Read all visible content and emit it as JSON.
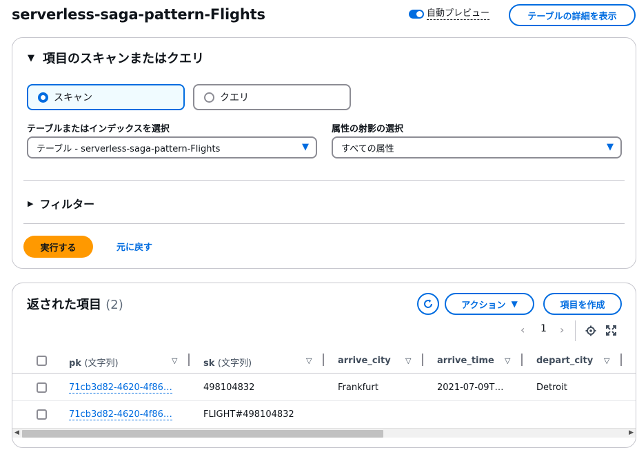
{
  "page": {
    "title": "serverless-saga-pattern-Flights",
    "auto_preview_label": "自動プレビュー",
    "table_details_button": "テーブルの詳細を表示"
  },
  "scan_panel": {
    "title": "項目のスキャンまたはクエリ",
    "scan_option": "スキャン",
    "query_option": "クエリ",
    "selected_mode": "scan",
    "table_select_label": "テーブルまたはインデックスを選択",
    "table_select_value": "テーブル - serverless-saga-pattern-Flights",
    "projection_label": "属性の射影の選択",
    "projection_value": "すべての属性",
    "filter_label": "フィルター",
    "run_button": "実行する",
    "reset_link": "元に戻す"
  },
  "results": {
    "title": "返された項目",
    "count": "(2)",
    "actions_button": "アクション",
    "create_button": "項目を作成",
    "page_number": "1",
    "columns": [
      {
        "name": "pk",
        "type": "(文字列)"
      },
      {
        "name": "sk",
        "type": "(文字列)"
      },
      {
        "name": "arrive_city",
        "type": ""
      },
      {
        "name": "arrive_time",
        "type": ""
      },
      {
        "name": "depart_city",
        "type": ""
      }
    ],
    "rows": [
      {
        "pk": "71cb3d82-4620-4f86…",
        "sk": "498104832",
        "arrive_city": "Frankfurt",
        "arrive_time": "2021-07-09T…",
        "depart_city": "Detroit"
      },
      {
        "pk": "71cb3d82-4620-4f86…",
        "sk": "FLIGHT#498104832",
        "arrive_city": "",
        "arrive_time": "",
        "depart_city": ""
      }
    ]
  },
  "icons": {
    "refresh": "refresh-icon",
    "settings": "gear-icon",
    "fullscreen": "expand-icon"
  },
  "colors": {
    "accent": "#006ce0",
    "primary_button": "#ff9900",
    "border": "#c6c6cd"
  }
}
